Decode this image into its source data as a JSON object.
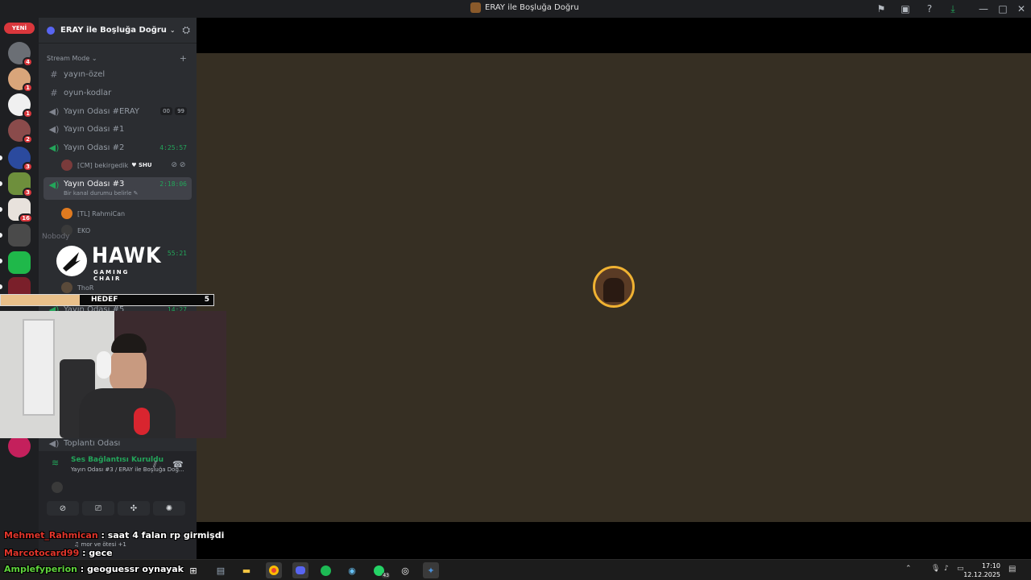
{
  "window": {
    "title": "ERAY ile Boşluğa Doğru"
  },
  "rail": {
    "new_label": "YENİ",
    "badges": [
      "4",
      "1",
      "1",
      "2",
      "3",
      "3",
      "16"
    ]
  },
  "guild": {
    "name": "ERAY ile Boşluğa Doğru"
  },
  "category": {
    "name": "Stream Mode"
  },
  "channels": [
    {
      "name": "yayın-özel",
      "type": "text"
    },
    {
      "name": "oyun-kodlar",
      "type": "text"
    },
    {
      "name": "Yayın Odası #ERAY",
      "type": "voice",
      "pill_a": "00",
      "pill_b": "99"
    },
    {
      "name": "Yayın Odası #1",
      "type": "voice"
    },
    {
      "name": "Yayın Odası #2",
      "type": "voice",
      "time": "4:25:57"
    },
    {
      "name": "Yayın Odası #3",
      "type": "voice",
      "time": "2:18:06",
      "status": "Bir kanal durumu belirle"
    },
    {
      "name": "Yayın Odası #5",
      "type": "voice",
      "time": "14:27"
    },
    {
      "name": "Toplantı Odası",
      "type": "voice"
    }
  ],
  "users": [
    {
      "name": "[CM] bekirgedik",
      "tag": "SHU"
    },
    {
      "name": "[TL] RahmiCan"
    },
    {
      "name": "EKO"
    },
    {
      "name": "ThoR"
    }
  ],
  "extra_time": "55:21",
  "nobody_text": "Nobody",
  "sponsor": {
    "word": "HAWK",
    "sub": "GAMING CHAIR"
  },
  "goal": {
    "label": "HEDEF",
    "count": "5",
    "progress": 0.37
  },
  "voice_panel": {
    "status": "Ses Bağlantısı Kuruldu",
    "location": "Yayın Odası #3 / ERAY ile Boşluğa Doğ..."
  },
  "now_playing": {
    "text": "mor ve ötesi +1"
  },
  "chat": [
    {
      "user": "Mehmet_Rahmican",
      "msg": " : saat 4 falan rp girmişdi"
    },
    {
      "user": "Marcotocard99",
      "msg": " : gece"
    },
    {
      "user": "Amplefyperion",
      "msg": " : geoguessr oynayak"
    }
  ],
  "taskbar": {
    "time": "17:10",
    "date": "12.12.2025",
    "whatsapp_badge": "43"
  },
  "colors": {
    "online": "#23a55a",
    "badge": "#da373c",
    "brand": "#5865f2",
    "stream_bg": "#362f23",
    "ring": "#f0b232"
  }
}
